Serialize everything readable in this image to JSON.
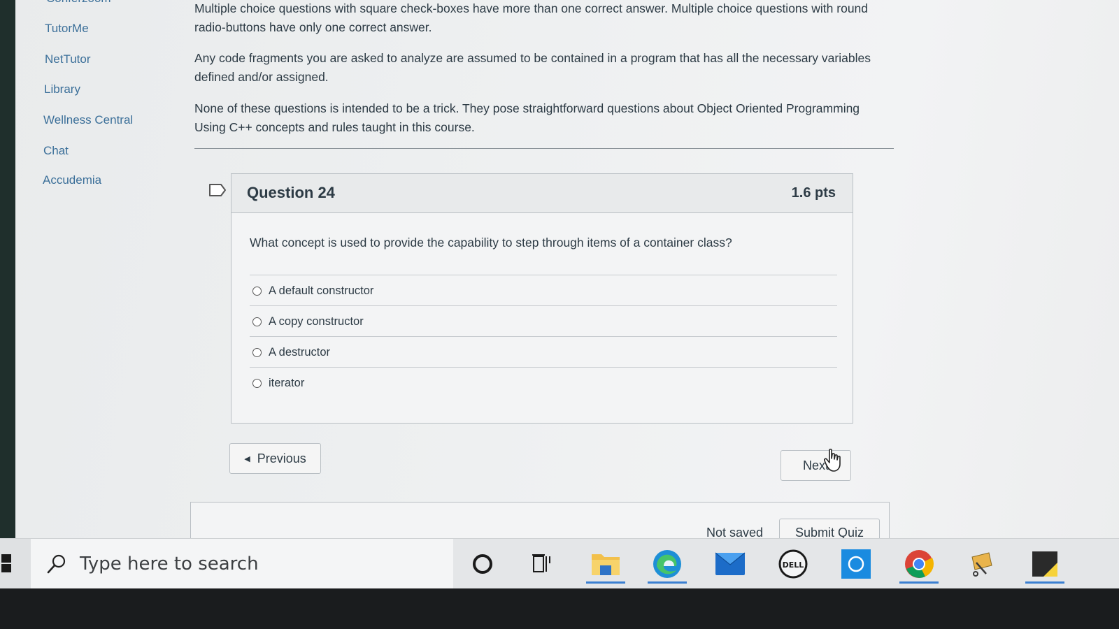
{
  "sidebar": {
    "top_cut": "Conferzoom",
    "items": [
      {
        "label": "TutorMe"
      },
      {
        "label": "NetTutor"
      },
      {
        "label": "Library"
      },
      {
        "label": "Wellness Central"
      },
      {
        "label": "Chat"
      },
      {
        "label": "Accudemia"
      }
    ]
  },
  "instructions": {
    "p1": "Multiple choice questions with square check-boxes have more than one correct answer.  Multiple choice questions with round radio-buttons have only one correct answer.",
    "p2": "Any code fragments you are asked to analyze are assumed to be contained in a program that has all the necessary variables defined and/or assigned.",
    "p3": "None of these questions is intended to be a trick.  They pose straightforward questions about Object Oriented Programming Using C++  concepts and rules taught in this course."
  },
  "question": {
    "title": "Question 24",
    "points": "1.6 pts",
    "text": "What concept is used to provide the capability to step through items of a container class?",
    "answers": [
      {
        "label": "A default constructor"
      },
      {
        "label": "A copy constructor"
      },
      {
        "label": "A destructor"
      },
      {
        "label": "iterator"
      }
    ]
  },
  "nav": {
    "previous_label": "Previous",
    "next_label": "Next"
  },
  "footer": {
    "status": "Not saved",
    "submit_label": "Submit Quiz"
  },
  "taskbar": {
    "search_placeholder": "Type here to search",
    "icons": [
      "cortana-icon",
      "task-view-icon",
      "file-explorer-icon",
      "edge-icon",
      "mail-icon",
      "dell-icon",
      "app-icon",
      "chrome-icon",
      "snip-icon",
      "sticky-notes-icon"
    ]
  },
  "colors": {
    "link": "#3b6f99",
    "text": "#2d3b45",
    "border": "#b9bfc4",
    "taskbar_active": "#3a7fd1"
  }
}
